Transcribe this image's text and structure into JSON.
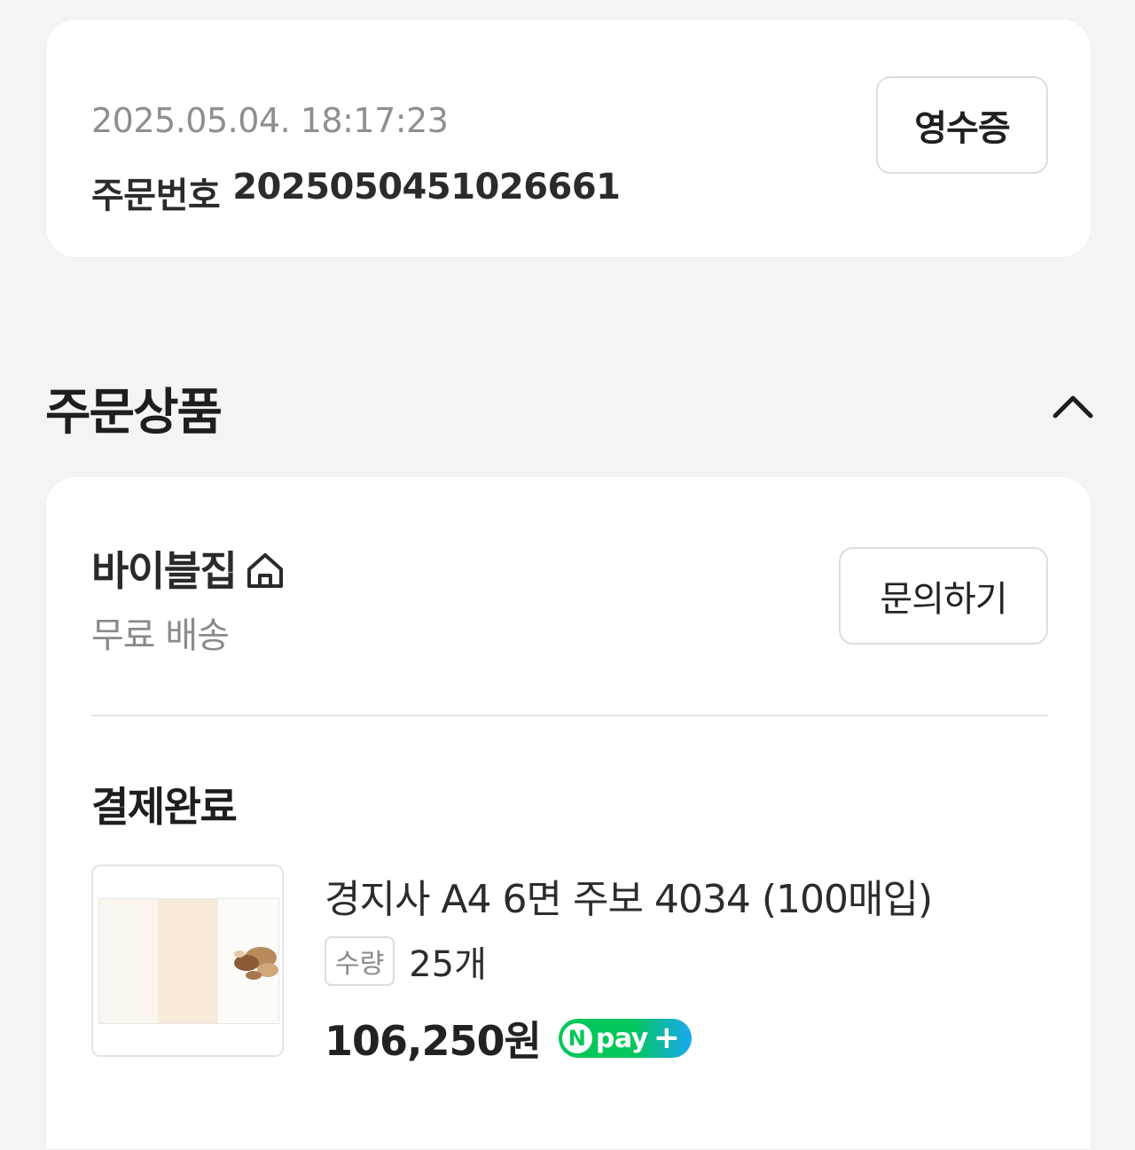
{
  "order": {
    "datetime": "2025.05.04. 18:17:23",
    "number_label": "주문번호",
    "number_value": "2025050451026661",
    "receipt_button": "영수증"
  },
  "section": {
    "title": "주문상품",
    "collapse_icon": "chevron-up-icon"
  },
  "store": {
    "name": "바이블집",
    "store_icon": "home-icon",
    "shipping": "무료 배송",
    "inquiry_button": "문의하기"
  },
  "item": {
    "status": "결제완료",
    "name": "경지사 A4 6면 주보 4034 (100매입)",
    "quantity_label": "수량",
    "quantity_value": "25개",
    "price": "106,250원",
    "pay_badge": {
      "letter": "N",
      "text": "pay",
      "plus": "+"
    }
  },
  "colors": {
    "npay_green": "#03c75a",
    "background": "#f3f4f6"
  }
}
